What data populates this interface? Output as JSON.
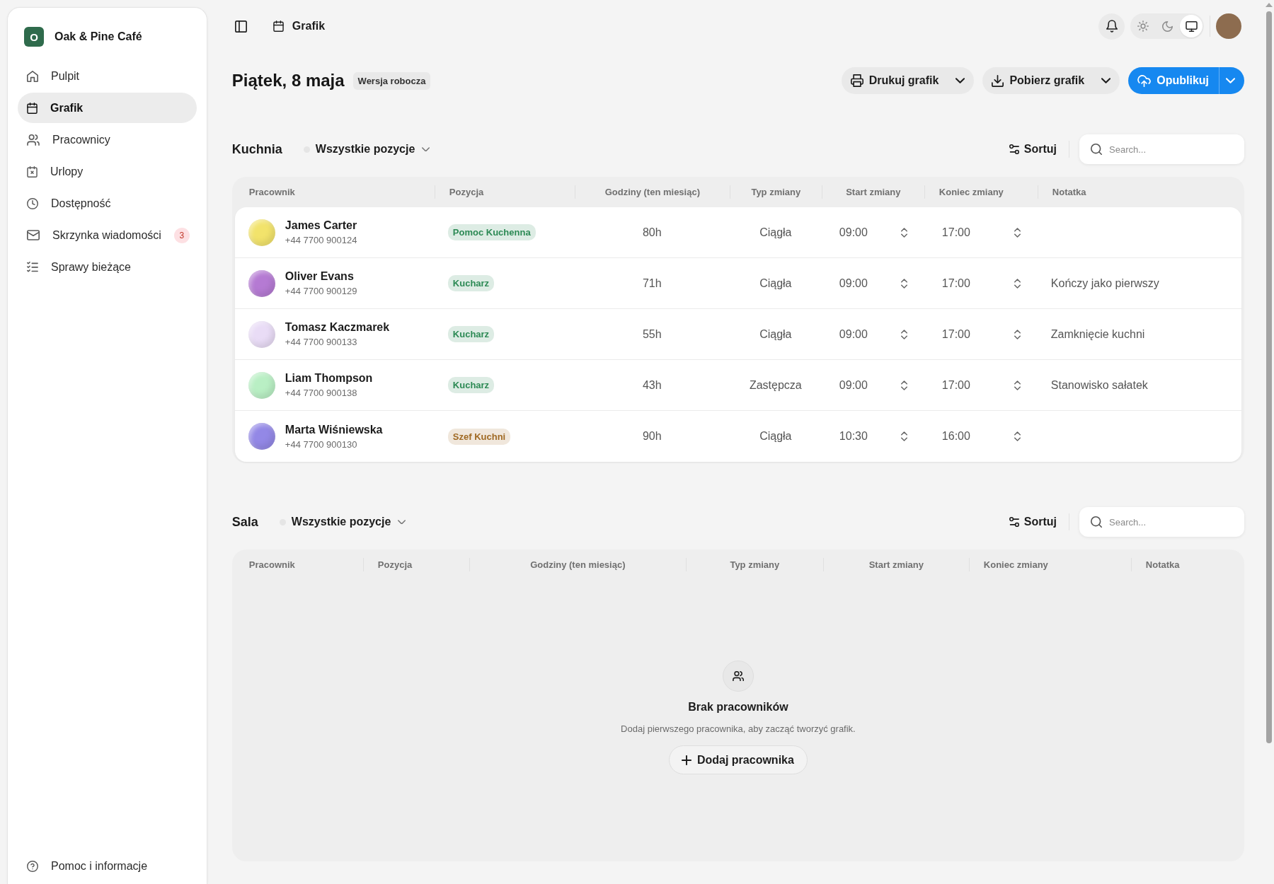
{
  "sidebar": {
    "brand": {
      "initial": "O",
      "name": "Oak & Pine Café"
    },
    "items": [
      {
        "label": "Pulpit",
        "selected": false
      },
      {
        "label": "Grafik",
        "selected": true
      },
      {
        "label": "Pracownicy",
        "selected": false
      },
      {
        "label": "Urlopy",
        "selected": false
      },
      {
        "label": "Dostępność",
        "selected": false
      },
      {
        "label": "Skrzynka wiadomości",
        "selected": false,
        "badge": "3"
      },
      {
        "label": "Sprawy bieżące",
        "selected": false
      }
    ],
    "footer": {
      "label": "Pomoc i informacje"
    }
  },
  "topbar": {
    "breadcrumb": "Grafik",
    "theme_options": [
      {
        "selected": false
      },
      {
        "selected": false
      },
      {
        "selected": true
      }
    ]
  },
  "header": {
    "title": "Piątek, 8 maja",
    "status": "Wersja robocza",
    "actions": [
      {
        "label": "Drukuj grafik",
        "kind": "secondary"
      },
      {
        "label": "Pobierz grafik",
        "kind": "secondary"
      },
      {
        "label": "Opublikuj",
        "kind": "primary"
      }
    ]
  },
  "sections": [
    {
      "title": "Kuchnia",
      "filter": "Wszystkie pozycje",
      "sort": "Sortuj",
      "search": {
        "placeholder": "Search..."
      },
      "columns": [
        "Pracownik",
        "Pozycja",
        "Godziny (ten miesiąc)",
        "Typ zmiany",
        "Start zmiany",
        "Koniec zmiany",
        "Notatka"
      ],
      "rows": [
        {
          "name": "James Carter",
          "phone": "+44 7700 900124",
          "color": "#f2e36b",
          "position": {
            "label": "Pomoc Kuchenna",
            "color": "#2d8a55"
          },
          "hours": "80h",
          "shift_type": "Ciągła",
          "start": "09:00",
          "end": "17:00"
        },
        {
          "name": "Oliver Evans",
          "phone": "+44 7700 900129",
          "color": "#b57ad3",
          "position": {
            "label": "Kucharz",
            "color": "#2d8a55"
          },
          "hours": "71h",
          "shift_type": "Ciągła",
          "start": "09:00",
          "end": "17:00",
          "note": "Kończy jako pierwszy"
        },
        {
          "name": "Tomasz Kaczmarek",
          "phone": "+44 7700 900133",
          "color": "#e9dcf6",
          "position": {
            "label": "Kucharz",
            "color": "#2d8a55"
          },
          "hours": "55h",
          "shift_type": "Ciągła",
          "start": "09:00",
          "end": "17:00",
          "note": "Zamknięcie kuchni"
        },
        {
          "name": "Liam Thompson",
          "phone": "+44 7700 900138",
          "color": "#b9efc4",
          "position": {
            "label": "Kucharz",
            "color": "#2d8a55"
          },
          "hours": "43h",
          "shift_type": "Zastępcza",
          "start": "09:00",
          "end": "17:00",
          "note": "Stanowisko sałatek"
        },
        {
          "name": "Marta Wiśniewska",
          "phone": "+44 7700 900130",
          "color": "#9388e6",
          "position": {
            "label": "Szef Kuchni",
            "color": "#a06a24"
          },
          "hours": "90h",
          "shift_type": "Ciągła",
          "start": "10:30",
          "end": "16:00"
        }
      ]
    },
    {
      "title": "Sala",
      "filter": "Wszystkie pozycje",
      "sort": "Sortuj",
      "search": {
        "placeholder": "Search..."
      },
      "columns": [
        "Pracownik",
        "Pozycja",
        "Godziny (ten miesiąc)",
        "Typ zmiany",
        "Start zmiany",
        "Koniec zmiany",
        "Notatka"
      ],
      "empty_state": {
        "title": "Brak pracowników",
        "message": "Dodaj pierwszego pracownika, aby zacząć tworzyć grafik.",
        "action": "Dodaj pracownika"
      }
    }
  ]
}
